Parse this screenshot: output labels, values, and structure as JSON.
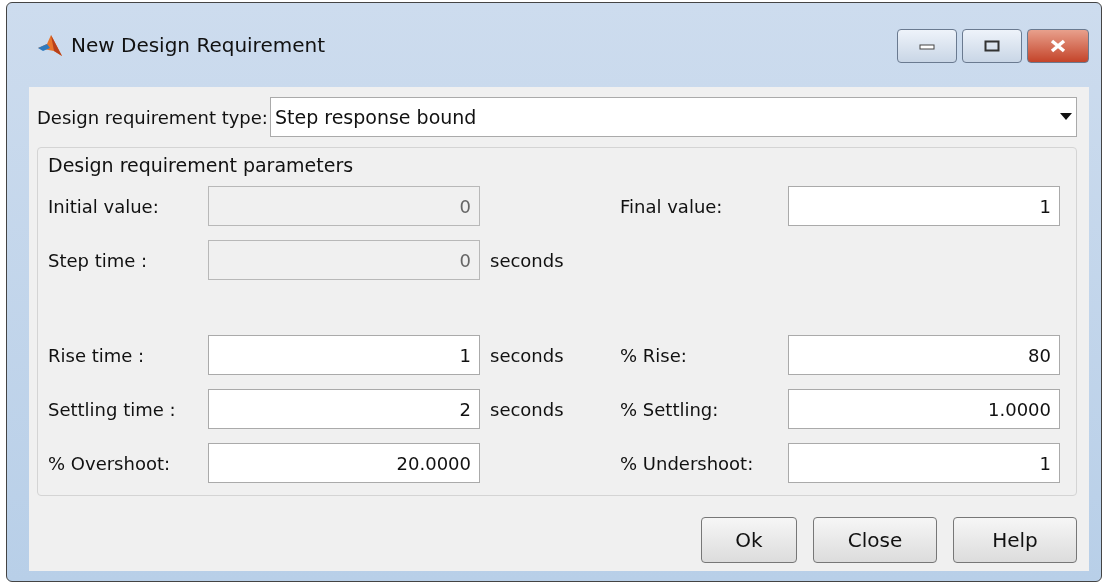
{
  "window": {
    "title": "New Design Requirement"
  },
  "requirement_type": {
    "label": "Design requirement type:",
    "value": "Step response bound"
  },
  "parameters": {
    "title": "Design requirement parameters",
    "groups": [
      [
        {
          "fields": [
            {
              "label": "Initial value:",
              "value": "0",
              "disabled": true
            },
            {
              "label": "Final value:",
              "value": "1",
              "disabled": false
            }
          ]
        },
        {
          "fields": [
            {
              "label": "Step time :",
              "value": "0",
              "disabled": true,
              "unit": "seconds"
            }
          ]
        }
      ],
      [
        {
          "fields": [
            {
              "label": "Rise time :",
              "value": "1",
              "disabled": false,
              "unit": "seconds"
            },
            {
              "label": "% Rise:",
              "value": "80",
              "disabled": false
            }
          ]
        },
        {
          "fields": [
            {
              "label": "Settling time :",
              "value": "2",
              "disabled": false,
              "unit": "seconds"
            },
            {
              "label": "% Settling:",
              "value": "1.0000",
              "disabled": false
            }
          ]
        },
        {
          "fields": [
            {
              "label": "% Overshoot:",
              "value": "20.0000",
              "disabled": false
            },
            {
              "label": "% Undershoot:",
              "value": "1",
              "disabled": false
            }
          ]
        }
      ]
    ]
  },
  "buttons": [
    "Ok",
    "Close",
    "Help"
  ]
}
